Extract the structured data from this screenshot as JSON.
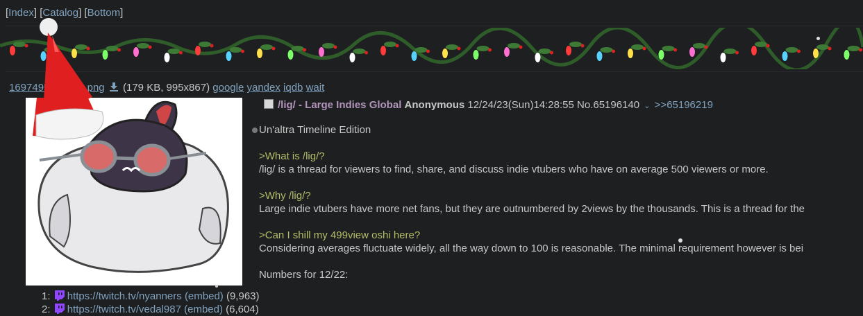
{
  "nav": {
    "index": "Index",
    "catalog": "Catalog",
    "bottom": "Bottom"
  },
  "file": {
    "name": "1697495963025.png",
    "size": "(179 KB, 995x867)",
    "search_links": [
      "google",
      "yandex",
      "iqdb",
      "wait"
    ]
  },
  "post": {
    "subject": "/lig/ - Large Indies Global",
    "name": "Anonymous",
    "datetime": "12/24/23(Sun)14:28:55",
    "number": "No.65196140",
    "reply_link": ">>65196219"
  },
  "body": {
    "intro": "Un'altra Timeline Edition",
    "sections": [
      {
        "q": ">What is /lig/?",
        "a": "/lig/ is a thread for viewers to find, share, and discuss indie vtubers who have on average 500 viewers or more."
      },
      {
        "q": ">Why /lig/?",
        "a": "Large indie vtubers have more net fans, but they are outnumbered by 2views by the thousands. This is a thread for the"
      },
      {
        "q": ">Can I shill my 499view oshi here?",
        "a": "Considering averages fluctuate widely, all the way down to 100 is reasonable. The minimal requirement however is bei"
      }
    ],
    "numbers_heading": "Numbers for 12/22:"
  },
  "streams": [
    {
      "rank": "1:",
      "url": "https://twitch.tv/nyanners",
      "embed": "(embed)",
      "count": "(9,963)"
    },
    {
      "rank": "2:",
      "url": "https://twitch.tv/vedal987",
      "embed": "(embed)",
      "count": "(6,604)"
    }
  ],
  "colors": {
    "background": "#1d1f21",
    "link": "#81a2be",
    "subject": "#b294bb",
    "greentext": "#b5bd68",
    "twitch": "#9146ff"
  }
}
